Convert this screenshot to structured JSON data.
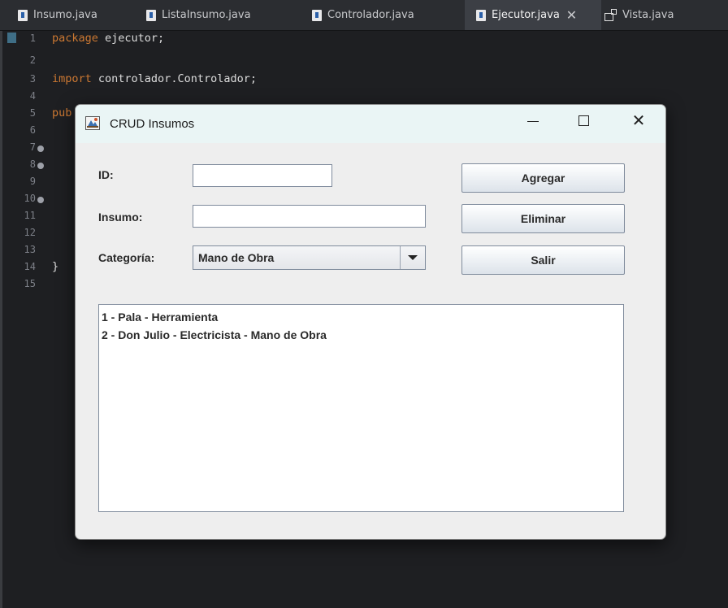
{
  "ide": {
    "tabs": [
      {
        "label": "Insumo.java",
        "icon": "java-file-icon",
        "active": false
      },
      {
        "label": "ListaInsumo.java",
        "icon": "java-file-icon",
        "active": false
      },
      {
        "label": "Controlador.java",
        "icon": "java-file-icon",
        "active": false
      },
      {
        "label": "Ejecutor.java",
        "icon": "java-file-icon",
        "active": true,
        "close": "✕"
      },
      {
        "label": "Vista.java",
        "icon": "form-file-icon",
        "active": false
      }
    ],
    "line_numbers": [
      "1",
      "2",
      "3",
      "4",
      "5",
      "6",
      "7",
      "8",
      "9",
      "10",
      "11",
      "12",
      "13",
      "14",
      "15"
    ],
    "code": {
      "line1_keyword": "package",
      "line1_rest": " ejecutor;",
      "line3_keyword": "import",
      "line3_rest": " controlador.Controlador;",
      "line5_keyword": "pub",
      "line14": "}"
    },
    "colors": {
      "keyword": "#cc7832",
      "background": "#1e1f22"
    }
  },
  "dialog": {
    "title": "CRUD Insumos",
    "controls": {
      "minimize": "—",
      "maximize": "☐",
      "close": "✕"
    },
    "labels": {
      "id": "ID:",
      "insumo": "Insumo:",
      "categoria": "Categoría:"
    },
    "fields": {
      "id_value": "",
      "insumo_value": ""
    },
    "categoria_selected": "Mano de Obra",
    "buttons": {
      "agregar": "Agregar",
      "eliminar": "Eliminar",
      "salir": "Salir"
    },
    "list_items": [
      "1 - Pala - Herramienta",
      "2 - Don Julio - Electricista - Mano de Obra"
    ]
  }
}
